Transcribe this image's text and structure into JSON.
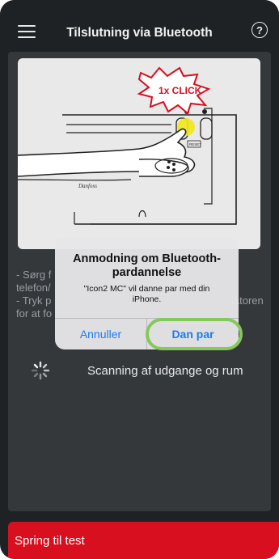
{
  "header": {
    "title": "Tilslutning via Bluetooth",
    "help_label": "?"
  },
  "illustration": {
    "badge_text": "1x CLICK",
    "reset_label": "RESET",
    "brand_mark": "Danfoss"
  },
  "instructions": {
    "lines": [
      "- Sørg f",
      "telefon/",
      "- Tryk p",
      "for at fo"
    ],
    "right_fragment": "latoren"
  },
  "scan": {
    "text": "Scanning af udgange og rum"
  },
  "bottom_button": {
    "label": "Spring til test"
  },
  "dialog": {
    "title": "Anmodning om Bluetooth-pardannelse",
    "message": "\"Icon2 MC\" vil danne par med din iPhone.",
    "cancel_label": "Annuller",
    "confirm_label": "Dan par"
  },
  "colors": {
    "background": "#1f2224",
    "panel": "#34383b",
    "accent_red": "#d70f1e",
    "ios_blue": "#1b7cf0",
    "highlight_green": "#86c85a"
  }
}
